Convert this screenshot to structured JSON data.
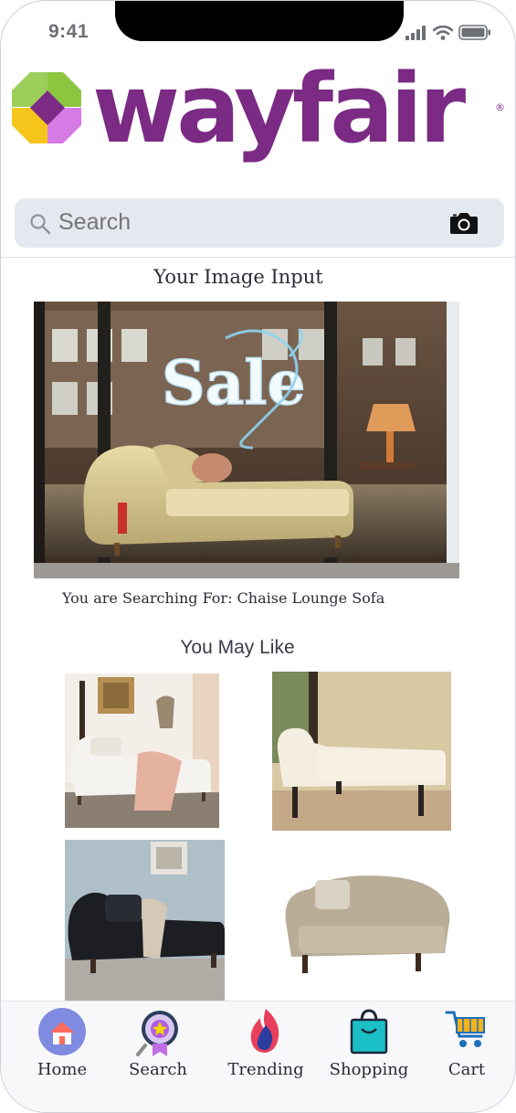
{
  "status_bar": {
    "time": "9:41"
  },
  "brand": {
    "name": "wayfair",
    "registered_mark": "®",
    "colors": {
      "primary": "#7b2b84",
      "lime": "#8cc63f",
      "yellow": "#f5c51b",
      "purple": "#7b2b84",
      "pink": "#d67ae6"
    }
  },
  "search": {
    "placeholder": "Search",
    "icons": [
      "search-icon",
      "camera-icon"
    ]
  },
  "image_input": {
    "title": "Your Image Input",
    "window_text": "Sale",
    "searching_for": "You are Searching For: Chaise Lounge Sofa"
  },
  "recommendations": {
    "title": "You May Like",
    "items": [
      {
        "name": "white-chaise-with-pink-throw"
      },
      {
        "name": "cream-tufted-chaise"
      },
      {
        "name": "black-chaise-with-throw"
      },
      {
        "name": "beige-tufted-chaise"
      }
    ]
  },
  "tab_bar": {
    "tabs": [
      {
        "label": "Home",
        "icon": "home-icon"
      },
      {
        "label": "Search",
        "icon": "search-badge-icon"
      },
      {
        "label": "Trending",
        "icon": "flame-icon"
      },
      {
        "label": "Shopping",
        "icon": "shopping-bag-icon"
      },
      {
        "label": "Cart",
        "icon": "cart-icon"
      }
    ]
  }
}
